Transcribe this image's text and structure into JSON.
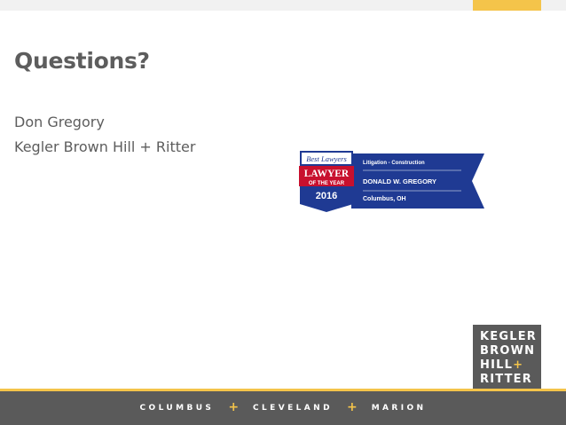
{
  "slide": {
    "title": "Questions?",
    "presenter_name": "Don Gregory",
    "firm_name": "Kegler Brown Hill + Ritter"
  },
  "award_badge": {
    "brand": "Best Lawyers",
    "honor_line1": "LAWYER",
    "honor_line2": "OF THE YEAR",
    "year": "2016",
    "practice_area": "Litigation - Construction",
    "lawyer_name": "DONALD W. GREGORY",
    "location": "Columbus, OH"
  },
  "logo": {
    "line1": "KEGLER",
    "line2": "BROWN",
    "line3_text": "HILL",
    "line3_plus": "+",
    "line4": "RITTER"
  },
  "footer": {
    "cities": [
      "COLUMBUS",
      "CLEVELAND",
      "MARION"
    ],
    "separator": "+"
  },
  "colors": {
    "accent": "#f4c44a",
    "text_gray": "#5d5d5d",
    "dark_gray": "#5a5a5a",
    "badge_navy": "#1f3a93",
    "badge_red": "#c8102e"
  }
}
